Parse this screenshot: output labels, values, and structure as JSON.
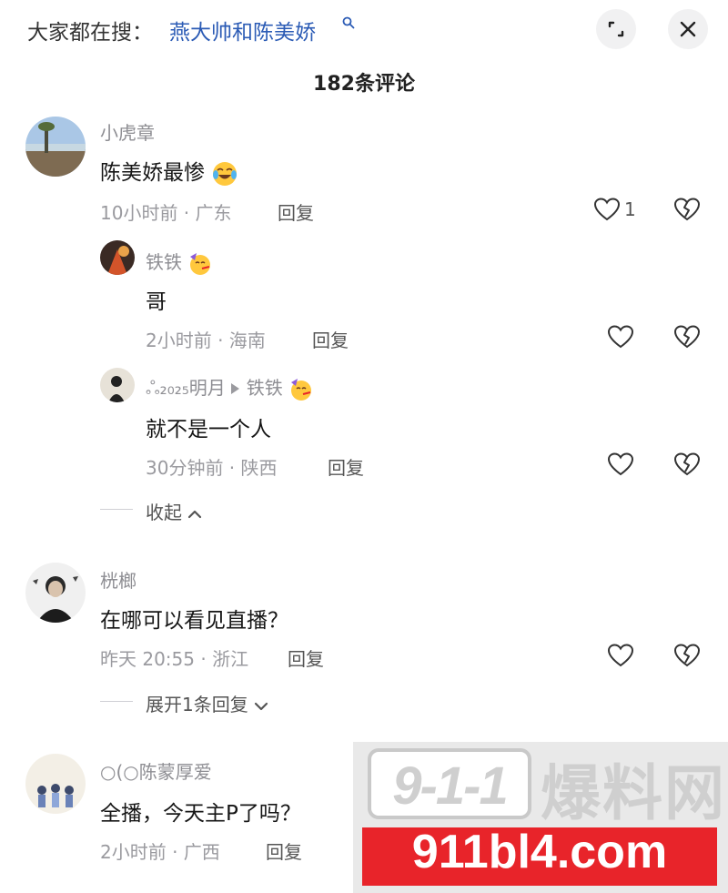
{
  "header": {
    "search_prefix": "大家都在搜：",
    "search_term": "燕大帅和陈美娇",
    "comment_count_title": "182条评论"
  },
  "comments": [
    {
      "username": "小虎章",
      "content": "陈美娇最惨",
      "content_emoji": "laughing-crying-emoji",
      "meta": "10小时前 · 广东",
      "reply_label": "回复",
      "like_count": "1",
      "replies": [
        {
          "username": "铁铁",
          "user_emoji": "party-face-emoji",
          "content": "哥",
          "meta": "2小时前 · 海南",
          "reply_label": "回复"
        },
        {
          "username": "ஃ₂₀₂₅明月",
          "reply_to": "铁铁",
          "user_emoji": "party-face-emoji",
          "content": "就不是一个人",
          "meta": "30分钟前 · 陕西",
          "reply_label": "回复"
        }
      ],
      "fold_label": "收起"
    },
    {
      "username": "桄榔",
      "content": "在哪可以看见直播？",
      "meta": "昨天 20:55 · 浙江",
      "reply_label": "回复",
      "expand_label": "展开1条回复"
    },
    {
      "username": "○(○陈蒙厚爱",
      "content": "全播，今天主P了吗？",
      "meta": "2小时前 · 广西",
      "reply_label": "回复"
    }
  ],
  "watermark": {
    "logo_text": "9-1-1",
    "name": "爆料网",
    "url": "911bl4.com",
    "accent_color": "#e8242a"
  }
}
